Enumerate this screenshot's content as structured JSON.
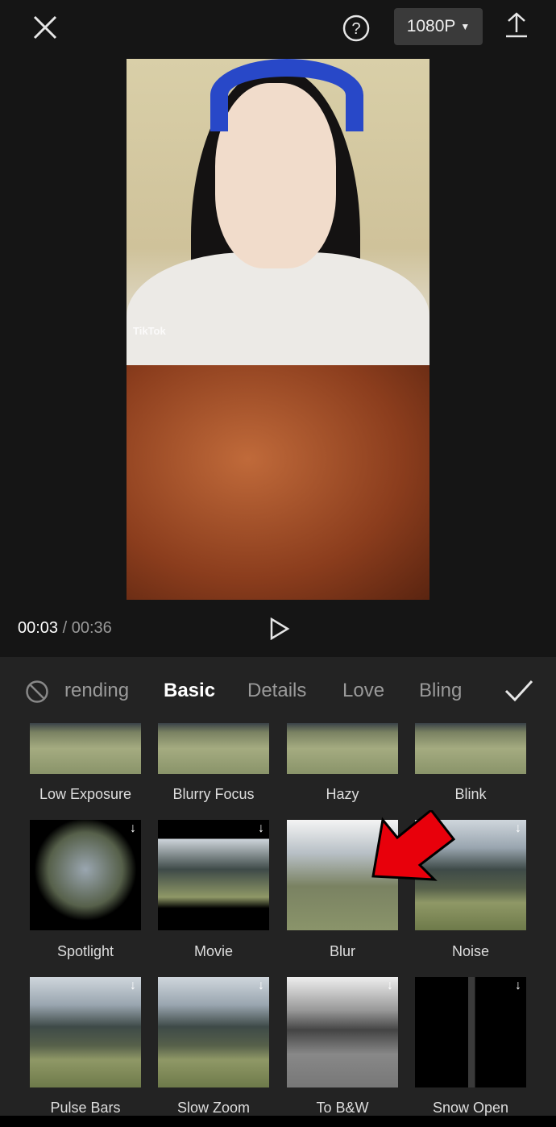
{
  "topbar": {
    "close_icon": "close-icon",
    "help_icon": "help-circle-icon",
    "resolution": "1080P",
    "export_icon": "upload-icon"
  },
  "video": {
    "watermark": "TikTok"
  },
  "playback": {
    "current": "00:03",
    "separator": " / ",
    "total": "00:36",
    "play_icon": "play-icon"
  },
  "tabs": {
    "none_icon": "no-effect-icon",
    "items": [
      "rending",
      "Basic",
      "Details",
      "Love",
      "Bling"
    ],
    "active": "Basic",
    "confirm_icon": "checkmark-icon"
  },
  "effects": [
    {
      "label": "Low Exposure"
    },
    {
      "label": "Blurry Focus"
    },
    {
      "label": "Hazy"
    },
    {
      "label": "Blink"
    },
    {
      "label": "Spotlight",
      "download": true
    },
    {
      "label": "Movie",
      "download": true
    },
    {
      "label": "Blur",
      "download": true
    },
    {
      "label": "Noise",
      "download": true
    },
    {
      "label": "Pulse Bars",
      "download": true
    },
    {
      "label": "Slow Zoom",
      "download": true
    },
    {
      "label": "To B&W",
      "download": true
    },
    {
      "label": "Snow Open",
      "download": true
    }
  ],
  "annotation": {
    "arrow_color": "#e8000b"
  }
}
